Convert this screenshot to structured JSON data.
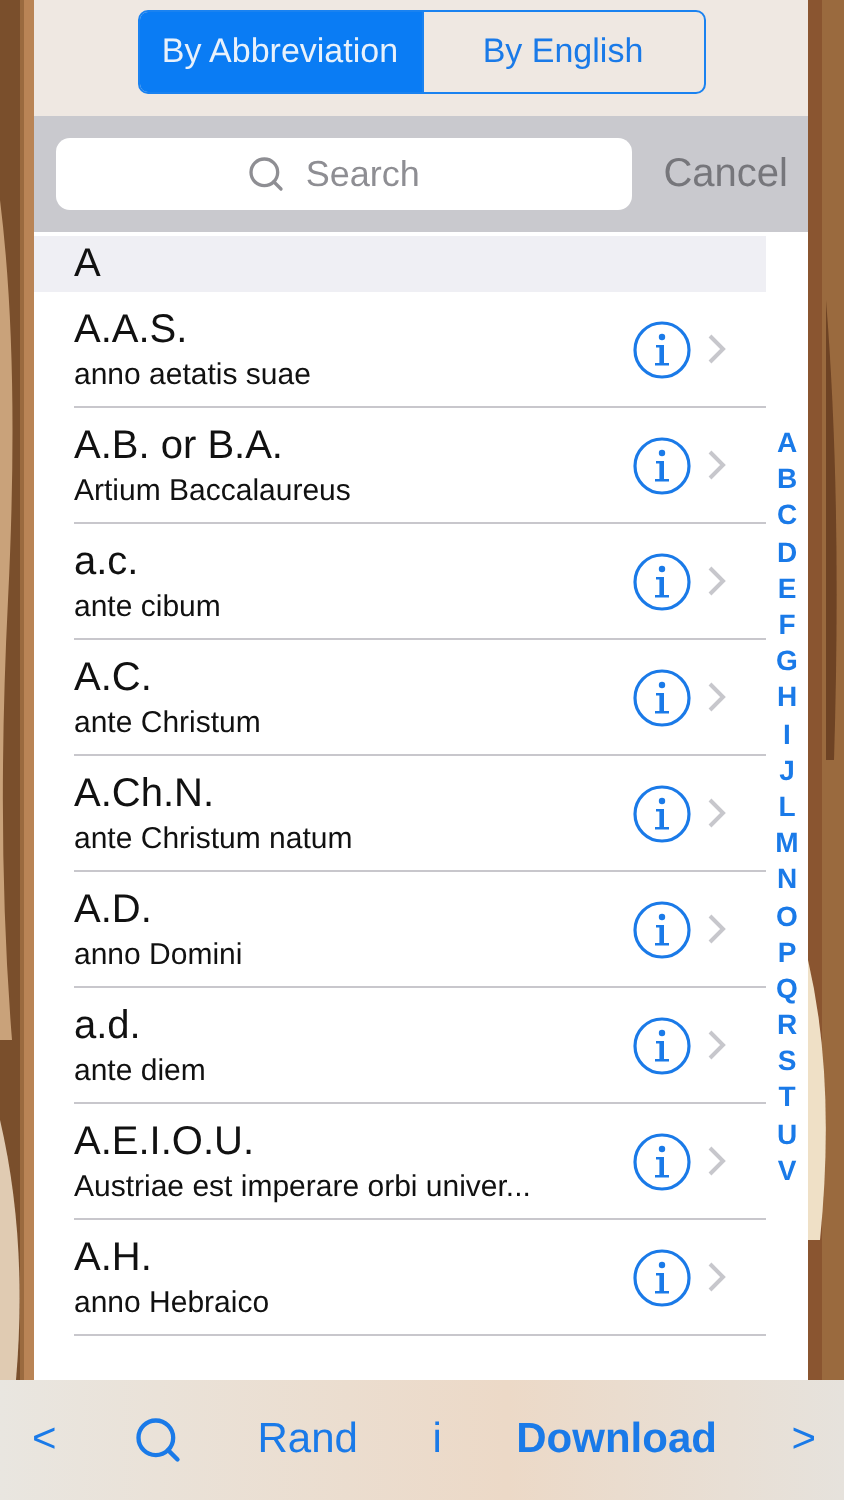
{
  "segments": [
    {
      "label": "By Abbreviation",
      "selected": true
    },
    {
      "label": "By English",
      "selected": false
    }
  ],
  "search": {
    "placeholder": "Search"
  },
  "cancel": {
    "label": "Cancel",
    "disabled": true
  },
  "section": "A",
  "rows": [
    {
      "title": "A.A.S.",
      "subtitle": "anno aetatis suae"
    },
    {
      "title": "A.B. or B.A.",
      "subtitle": "Artium Baccalaureus"
    },
    {
      "title": "a.c.",
      "subtitle": "ante cibum"
    },
    {
      "title": "A.C.",
      "subtitle": "ante Christum"
    },
    {
      "title": "A.Ch.N.",
      "subtitle": "ante Christum natum"
    },
    {
      "title": "A.D.",
      "subtitle": "anno Domini"
    },
    {
      "title": "a.d.",
      "subtitle": "ante diem"
    },
    {
      "title": "A.E.I.O.U.",
      "subtitle": "Austriae est imperare orbi univer..."
    },
    {
      "title": "A.H.",
      "subtitle": "anno Hebraico"
    }
  ],
  "index": [
    "A",
    "B",
    "C",
    "D",
    "E",
    "F",
    "G",
    "H",
    "I",
    "J",
    "L",
    "M",
    "N",
    "O",
    "P",
    "Q",
    "R",
    "S",
    "T",
    "U",
    "V"
  ],
  "toolbar": [
    {
      "kind": "text",
      "label": "<"
    },
    {
      "kind": "search"
    },
    {
      "kind": "text",
      "label": "Rand"
    },
    {
      "kind": "text",
      "label": "i"
    },
    {
      "kind": "bold",
      "label": "Download"
    },
    {
      "kind": "text",
      "label": ">"
    }
  ]
}
